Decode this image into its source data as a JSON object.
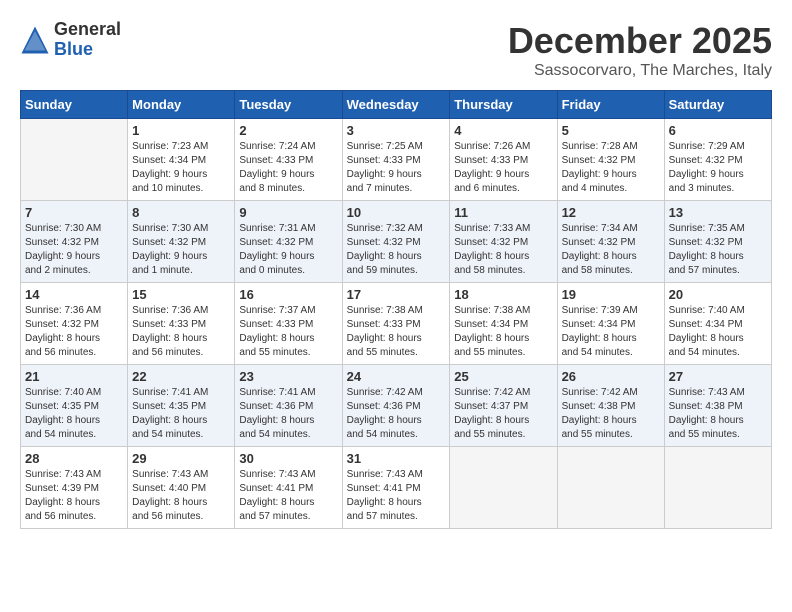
{
  "header": {
    "logo_general": "General",
    "logo_blue": "Blue",
    "month_title": "December 2025",
    "location": "Sassocorvaro, The Marches, Italy"
  },
  "weekdays": [
    "Sunday",
    "Monday",
    "Tuesday",
    "Wednesday",
    "Thursday",
    "Friday",
    "Saturday"
  ],
  "weeks": [
    [
      {
        "day": "",
        "info": ""
      },
      {
        "day": "1",
        "info": "Sunrise: 7:23 AM\nSunset: 4:34 PM\nDaylight: 9 hours\nand 10 minutes."
      },
      {
        "day": "2",
        "info": "Sunrise: 7:24 AM\nSunset: 4:33 PM\nDaylight: 9 hours\nand 8 minutes."
      },
      {
        "day": "3",
        "info": "Sunrise: 7:25 AM\nSunset: 4:33 PM\nDaylight: 9 hours\nand 7 minutes."
      },
      {
        "day": "4",
        "info": "Sunrise: 7:26 AM\nSunset: 4:33 PM\nDaylight: 9 hours\nand 6 minutes."
      },
      {
        "day": "5",
        "info": "Sunrise: 7:28 AM\nSunset: 4:32 PM\nDaylight: 9 hours\nand 4 minutes."
      },
      {
        "day": "6",
        "info": "Sunrise: 7:29 AM\nSunset: 4:32 PM\nDaylight: 9 hours\nand 3 minutes."
      }
    ],
    [
      {
        "day": "7",
        "info": "Sunrise: 7:30 AM\nSunset: 4:32 PM\nDaylight: 9 hours\nand 2 minutes."
      },
      {
        "day": "8",
        "info": "Sunrise: 7:30 AM\nSunset: 4:32 PM\nDaylight: 9 hours\nand 1 minute."
      },
      {
        "day": "9",
        "info": "Sunrise: 7:31 AM\nSunset: 4:32 PM\nDaylight: 9 hours\nand 0 minutes."
      },
      {
        "day": "10",
        "info": "Sunrise: 7:32 AM\nSunset: 4:32 PM\nDaylight: 8 hours\nand 59 minutes."
      },
      {
        "day": "11",
        "info": "Sunrise: 7:33 AM\nSunset: 4:32 PM\nDaylight: 8 hours\nand 58 minutes."
      },
      {
        "day": "12",
        "info": "Sunrise: 7:34 AM\nSunset: 4:32 PM\nDaylight: 8 hours\nand 58 minutes."
      },
      {
        "day": "13",
        "info": "Sunrise: 7:35 AM\nSunset: 4:32 PM\nDaylight: 8 hours\nand 57 minutes."
      }
    ],
    [
      {
        "day": "14",
        "info": "Sunrise: 7:36 AM\nSunset: 4:32 PM\nDaylight: 8 hours\nand 56 minutes."
      },
      {
        "day": "15",
        "info": "Sunrise: 7:36 AM\nSunset: 4:33 PM\nDaylight: 8 hours\nand 56 minutes."
      },
      {
        "day": "16",
        "info": "Sunrise: 7:37 AM\nSunset: 4:33 PM\nDaylight: 8 hours\nand 55 minutes."
      },
      {
        "day": "17",
        "info": "Sunrise: 7:38 AM\nSunset: 4:33 PM\nDaylight: 8 hours\nand 55 minutes."
      },
      {
        "day": "18",
        "info": "Sunrise: 7:38 AM\nSunset: 4:34 PM\nDaylight: 8 hours\nand 55 minutes."
      },
      {
        "day": "19",
        "info": "Sunrise: 7:39 AM\nSunset: 4:34 PM\nDaylight: 8 hours\nand 54 minutes."
      },
      {
        "day": "20",
        "info": "Sunrise: 7:40 AM\nSunset: 4:34 PM\nDaylight: 8 hours\nand 54 minutes."
      }
    ],
    [
      {
        "day": "21",
        "info": "Sunrise: 7:40 AM\nSunset: 4:35 PM\nDaylight: 8 hours\nand 54 minutes."
      },
      {
        "day": "22",
        "info": "Sunrise: 7:41 AM\nSunset: 4:35 PM\nDaylight: 8 hours\nand 54 minutes."
      },
      {
        "day": "23",
        "info": "Sunrise: 7:41 AM\nSunset: 4:36 PM\nDaylight: 8 hours\nand 54 minutes."
      },
      {
        "day": "24",
        "info": "Sunrise: 7:42 AM\nSunset: 4:36 PM\nDaylight: 8 hours\nand 54 minutes."
      },
      {
        "day": "25",
        "info": "Sunrise: 7:42 AM\nSunset: 4:37 PM\nDaylight: 8 hours\nand 55 minutes."
      },
      {
        "day": "26",
        "info": "Sunrise: 7:42 AM\nSunset: 4:38 PM\nDaylight: 8 hours\nand 55 minutes."
      },
      {
        "day": "27",
        "info": "Sunrise: 7:43 AM\nSunset: 4:38 PM\nDaylight: 8 hours\nand 55 minutes."
      }
    ],
    [
      {
        "day": "28",
        "info": "Sunrise: 7:43 AM\nSunset: 4:39 PM\nDaylight: 8 hours\nand 56 minutes."
      },
      {
        "day": "29",
        "info": "Sunrise: 7:43 AM\nSunset: 4:40 PM\nDaylight: 8 hours\nand 56 minutes."
      },
      {
        "day": "30",
        "info": "Sunrise: 7:43 AM\nSunset: 4:41 PM\nDaylight: 8 hours\nand 57 minutes."
      },
      {
        "day": "31",
        "info": "Sunrise: 7:43 AM\nSunset: 4:41 PM\nDaylight: 8 hours\nand 57 minutes."
      },
      {
        "day": "",
        "info": ""
      },
      {
        "day": "",
        "info": ""
      },
      {
        "day": "",
        "info": ""
      }
    ]
  ]
}
